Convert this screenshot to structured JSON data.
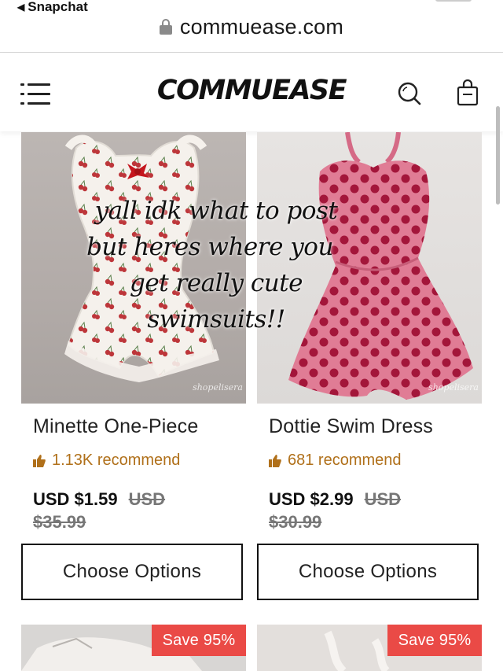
{
  "status": {
    "back_label": "Snapchat"
  },
  "browser": {
    "url": "commuease.com"
  },
  "header": {
    "logo": "COMMUEASE"
  },
  "overlay_caption": {
    "line1": "yall idk what to post",
    "line2": "but heres where you",
    "line3": "get really cute",
    "line4": "swimsuits!!"
  },
  "products": [
    {
      "name": "Minette One-Piece",
      "recommend": "1.13K recommend",
      "price": "USD $1.59",
      "old_price_currency": "USD",
      "old_price_value": "$35.99",
      "button": "Choose Options",
      "watermark": "shopelisera"
    },
    {
      "name": "Dottie Swim Dress",
      "recommend": "681 recommend",
      "price": "USD $2.99",
      "old_price_currency": "USD",
      "old_price_value": "$30.99",
      "button": "Choose Options",
      "watermark": "shopelisera"
    }
  ],
  "next_row": [
    {
      "badge": "Save 95%"
    },
    {
      "badge": "Save 95%"
    }
  ],
  "colors": {
    "accent_recommend": "#b0701a",
    "save_badge": "#ea4a46"
  }
}
